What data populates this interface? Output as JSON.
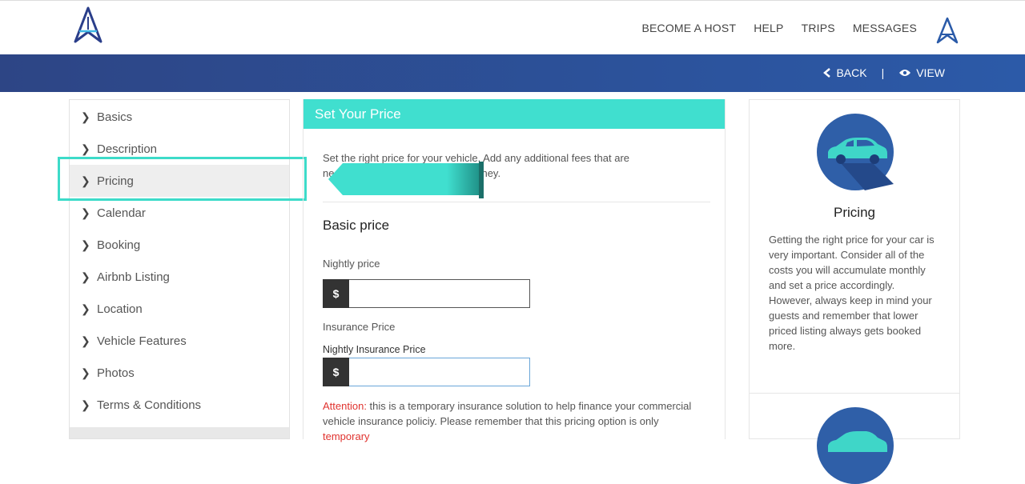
{
  "header": {
    "nav": [
      "BECOME A HOST",
      "HELP",
      "TRIPS",
      "MESSAGES"
    ]
  },
  "toolbar": {
    "back_label": "BACK",
    "separator": "|",
    "view_label": "VIEW"
  },
  "sidebar": {
    "items": [
      {
        "label": "Basics"
      },
      {
        "label": "Description"
      },
      {
        "label": "Pricing"
      },
      {
        "label": "Calendar"
      },
      {
        "label": "Booking"
      },
      {
        "label": "Airbnb Listing"
      },
      {
        "label": "Location"
      },
      {
        "label": "Vehicle Features"
      },
      {
        "label": "Photos"
      },
      {
        "label": "Terms & Conditions"
      }
    ],
    "active": "Pricing"
  },
  "main": {
    "title": "Set Your Price",
    "intro_line1": "Set the right price for your vehicle. Add any additional fees that are",
    "intro_line2_start": "ne",
    "intro_line2_end": "ney.",
    "section_title": "Basic price",
    "nightly_label": "Nightly price",
    "nightly_prefix": "$",
    "nightly_value": "",
    "insurance_label": "Insurance Price",
    "nightly_insurance_label": "Nightly Insurance Price",
    "insurance_prefix": "$",
    "insurance_value": "",
    "attention_label": "Attention:",
    "attention_text": " this is a temporary insurance solution to help finance your commercial vehicle insurance policiy. Please remember that this pricing option is only ",
    "attention_link": "temporary"
  },
  "right_panel": {
    "title": "Pricing",
    "description": "Getting the right price for your car is very important. Consider all of the costs you will accumulate monthly and set a price accordingly. However, always keep in mind your guests and remember that lower priced listing always gets booked more."
  },
  "colors": {
    "accent": "#40dfcf",
    "header_bar": "#2c4e96",
    "alert": "#e0332f",
    "icon_circle": "#2f5fa8"
  },
  "icons": {
    "logo": "a-logo-icon",
    "back": "chevron-left-icon",
    "view": "eye-icon",
    "sidebar": "chevron-right-icon",
    "panel": "car-icon"
  }
}
